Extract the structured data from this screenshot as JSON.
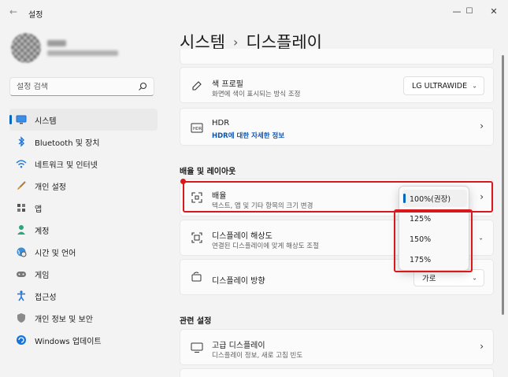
{
  "window": {
    "app_title": "설정",
    "back_glyph": "←",
    "minimize_glyph": "—",
    "maximize_glyph": "☐",
    "close_glyph": "✕"
  },
  "search": {
    "placeholder": "설정 검색"
  },
  "sidebar": {
    "items": [
      {
        "label": "시스템",
        "icon": "monitor-icon",
        "active": true
      },
      {
        "label": "Bluetooth 및 장치",
        "icon": "bluetooth-icon"
      },
      {
        "label": "네트워크 및 인터넷",
        "icon": "wifi-icon"
      },
      {
        "label": "개인 설정",
        "icon": "brush-icon"
      },
      {
        "label": "앱",
        "icon": "apps-icon"
      },
      {
        "label": "계정",
        "icon": "person-icon"
      },
      {
        "label": "시간 및 언어",
        "icon": "globe-clock-icon"
      },
      {
        "label": "게임",
        "icon": "gamepad-icon"
      },
      {
        "label": "접근성",
        "icon": "accessibility-icon"
      },
      {
        "label": "개인 정보 및 보안",
        "icon": "shield-icon"
      },
      {
        "label": "Windows 업데이트",
        "icon": "update-icon"
      }
    ]
  },
  "breadcrumb": {
    "parent": "시스템",
    "separator": "›",
    "current": "디스플레이"
  },
  "color_profile": {
    "title": "색 프로필",
    "subtitle": "화면에 색이 표시되는 방식 조정",
    "value": "LG ULTRAWIDE"
  },
  "hdr": {
    "title": "HDR",
    "link": "HDR에 대한 자세한 정보"
  },
  "scale_section": {
    "title": "배율 및 레이아웃"
  },
  "scale": {
    "title": "배율",
    "subtitle": "텍스트, 앱 및 기타 항목의 크기 변경"
  },
  "resolution": {
    "title": "디스플레이 해상도",
    "subtitle": "연결된 디스플레이에 맞게 해상도 조절"
  },
  "orientation": {
    "title": "디스플레이 방향",
    "value": "가로"
  },
  "related_section": {
    "title": "관련 설정"
  },
  "advanced": {
    "title": "고급 디스플레이",
    "subtitle": "디스플레이 정보, 새로 고침 빈도"
  },
  "scale_popup": {
    "options": [
      "100%(권장)",
      "125%",
      "150%",
      "175%"
    ],
    "selected_index": 0
  },
  "colors": {
    "accent": "#0067c0",
    "highlight": "#d9181e",
    "link": "#0f56b3"
  }
}
